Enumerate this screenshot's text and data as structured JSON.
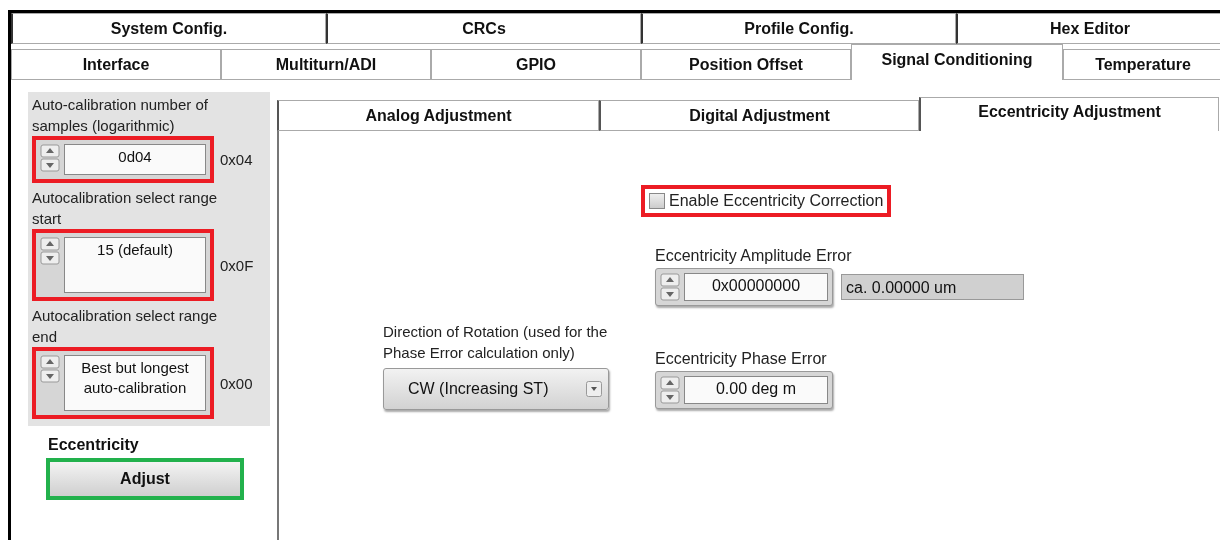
{
  "main_tabs_top": [
    {
      "label": "System Config.",
      "selected": false
    },
    {
      "label": "CRCs",
      "selected": false
    },
    {
      "label": "Profile Config.",
      "selected": false
    },
    {
      "label": "Hex Editor",
      "selected": false
    }
  ],
  "main_tabs": [
    {
      "label": "Interface",
      "selected": false
    },
    {
      "label": "Multiturn/ADI",
      "selected": false
    },
    {
      "label": "GPIO",
      "selected": false
    },
    {
      "label": "Position Offset",
      "selected": false
    },
    {
      "label": "Signal Conditioning",
      "selected": true
    },
    {
      "label": "Temperature",
      "selected": false
    }
  ],
  "calibration_panel": {
    "settings": [
      {
        "label": "Auto-calibration number of samples (logarithmic)",
        "value": "0d04",
        "hex": "0x04",
        "color": "#ec1c24"
      },
      {
        "label": "Autocalibration select range start",
        "value": "15 (default)",
        "hex": "0x0F",
        "color": "#ec1c24"
      },
      {
        "label": "Autocalibration select range end",
        "value": "Best but longest auto-calibration",
        "hex": "0x00",
        "color": "#ec1c24"
      }
    ],
    "eccentricity": {
      "label": "Eccentricity",
      "button": "Adjust",
      "color": "#22b14c"
    }
  },
  "sub_tabs": [
    {
      "label": "Analog Adjustment",
      "selected": false
    },
    {
      "label": "Digital Adjustment",
      "selected": false
    },
    {
      "label": "Eccentricity Adjustment",
      "selected": true
    }
  ],
  "eccentricity_adjustment": {
    "enable": {
      "label": "Enable Eccentricity Correction",
      "checked": false,
      "color": "#ec1c24"
    },
    "amplitude": {
      "label": "Eccentricity Amplitude Error",
      "value": "0x00000000",
      "readout": "ca. 0.00000 um"
    },
    "direction": {
      "label": "Direction of Rotation (used for the Phase Error calculation only)",
      "value": "CW (Increasing ST)"
    },
    "phase": {
      "label": "Eccentricity Phase Error",
      "value": "0.00 deg m"
    }
  }
}
